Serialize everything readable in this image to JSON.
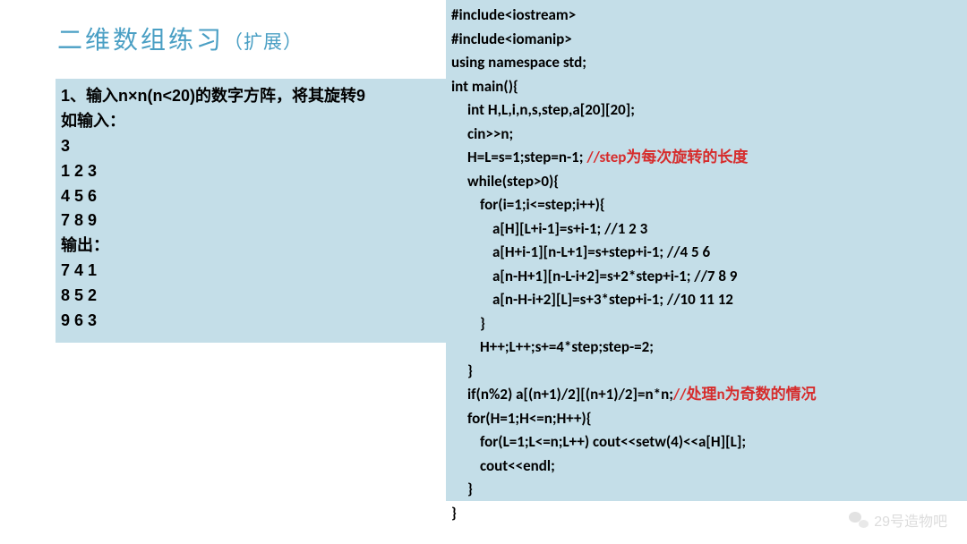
{
  "title": {
    "main": "二维数组练习",
    "sub": "（扩展）"
  },
  "problem": {
    "lines": [
      "1、输入n×n(n<20)的数字方阵，将其旋转9",
      "如输入：",
      "3",
      "1 2 3",
      "4 5 6",
      "7 8 9",
      "输出：",
      "7 4 1",
      "8 5 2",
      "9 6 3"
    ]
  },
  "code": {
    "l1": "#include<iostream>",
    "l2": "#include<iomanip>",
    "l3": "using namespace std;",
    "l4": "int main(){",
    "l5": "int H,L,i,n,s,step,a[20][20];",
    "l6": "cin>>n;",
    "l7a": "H=L=s=1;step=n-1; ",
    "l7b": "//step为每次旋转的长度",
    "l8": "while(step>0){",
    "l9": "for(i=1;i<=step;i++){",
    "l10": "a[H][L+i-1]=s+i-1; //1 2 3",
    "l11": "a[H+i-1][n-L+1]=s+step+i-1; //4 5 6",
    "l12": "a[n-H+1][n-L-i+2]=s+2*step+i-1; //7 8 9",
    "l13": "a[n-H-i+2][L]=s+3*step+i-1; //10 11 12",
    "l14": "}",
    "l15": "H++;L++;s+=4*step;step-=2;",
    "l16": "}",
    "l17a": "if(n%2) a[(n+1)/2][(n+1)/2]=n*n;",
    "l17b": "//处理n为奇数的情况",
    "l18": "for(H=1;H<=n;H++){",
    "l19": "for(L=1;L<=n;L++) cout<<setw(4)<<a[H][L];",
    "l20": "cout<<endl;",
    "l21": "}",
    "l22": "}"
  },
  "watermark": {
    "text": "29号造物吧"
  }
}
